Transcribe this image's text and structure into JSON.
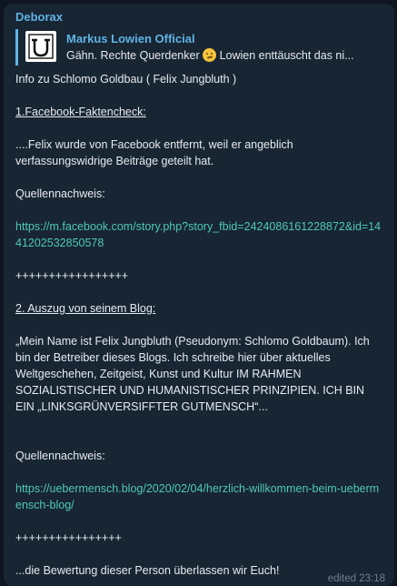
{
  "sender": "Deborax",
  "reply": {
    "author": "Markus Lowien Official",
    "text_before": "Gähn.   Rechte Querdenker ",
    "emoji": "face-with-hand-over-mouth",
    "text_after": "  Lowien enttäuscht das ni..."
  },
  "message": {
    "line1": "Info zu Schlomo Goldbau ( Felix Jungbluth )",
    "heading1": "1.Facebook-Faktencheck:",
    "para1": "....Felix wurde von Facebook entfernt, weil er angeblich verfassungswidrige Beiträge geteilt hat.",
    "source_label1": "Quellennachweis:",
    "link1": "https://m.facebook.com/story.php?story_fbid=2424086161228872&id=1441202532850578",
    "separator1": "+++++++++++++++++",
    "heading2": "2. Auszug von seinem Blog:",
    "quote": "„Mein Name ist Felix Jungbluth (Pseudonym: Schlomo Goldbaum). Ich bin der Betreiber dieses Blogs. Ich schreibe hier über aktuelles Weltgeschehen, Zeitgeist, Kunst und Kultur IM RAHMEN SOZIALISTISCHER UND HUMANISTISCHER PRINZIPIEN. ICH BIN EIN „LINKSGRÜNVERSIFFTER GUTMENSCH“...",
    "source_label2": "Quellennachweis:",
    "link2": "https://uebermensch.blog/2020/02/04/herzlich-willkommen-beim-uebermensch-blog/",
    "separator2": "++++++++++++++++",
    "closing": "...die Bewertung dieser Person überlassen wir Euch!"
  },
  "meta": "edited 23:18"
}
